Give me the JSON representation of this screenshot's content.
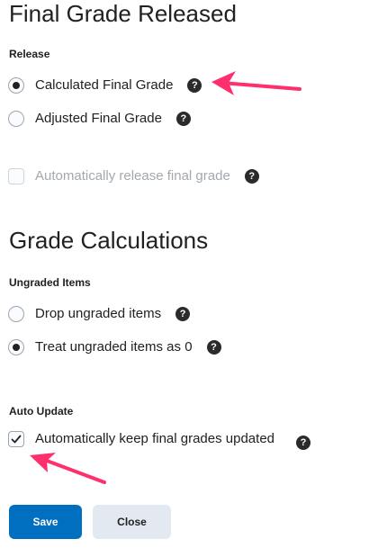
{
  "release_section": {
    "title": "Final Grade Released",
    "label": "Release",
    "options": [
      {
        "label": "Calculated Final Grade",
        "selected": true
      },
      {
        "label": "Adjusted Final Grade",
        "selected": false
      }
    ],
    "auto_release": {
      "label": "Automatically release final grade",
      "checked": false,
      "disabled": true
    }
  },
  "calc_section": {
    "title": "Grade Calculations",
    "ungraded_label": "Ungraded Items",
    "options": [
      {
        "label": "Drop ungraded items",
        "selected": false
      },
      {
        "label": "Treat ungraded items as 0",
        "selected": true
      }
    ],
    "auto_update_label": "Auto Update",
    "auto_update": {
      "label": "Automatically keep final grades updated",
      "checked": true
    }
  },
  "help_icon_glyph": "?",
  "buttons": {
    "save": "Save",
    "close": "Close"
  },
  "colors": {
    "primary": "#006fbf",
    "secondary": "#e3e9f1",
    "annotation_arrow": "#ff2e6c"
  },
  "icons": {
    "help": "help-question-icon",
    "checkmark": "checkmark-icon",
    "arrow": "annotation-arrow-icon"
  }
}
